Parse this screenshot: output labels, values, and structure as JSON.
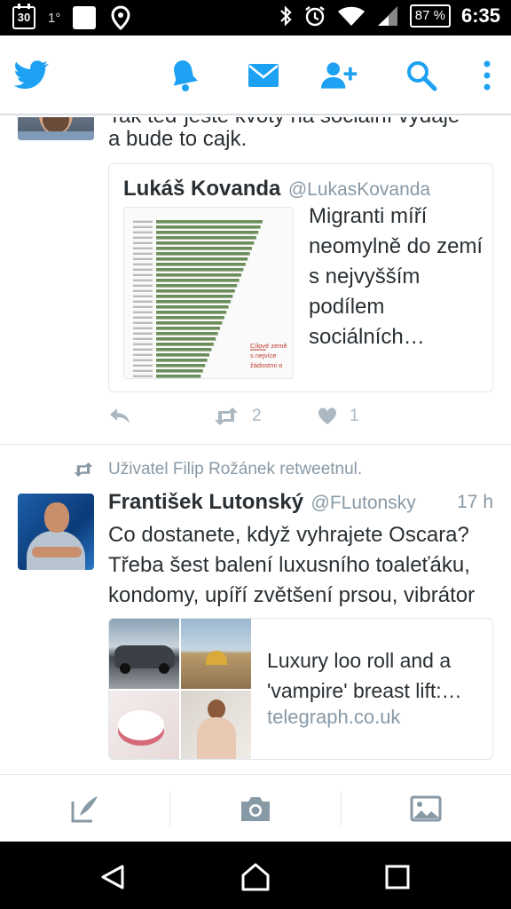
{
  "status_bar": {
    "calendar_day": "30",
    "temperature": "1°",
    "battery": "87 %",
    "time": "6:35"
  },
  "app_bar": {
    "icons": [
      "twitter-logo",
      "notifications-bell",
      "messages-envelope",
      "add-user",
      "search",
      "overflow-menu"
    ],
    "accent_color": "#1da1f2"
  },
  "tweet1": {
    "text_cut": "Tak teď ještě kvóty na sociální výdaje",
    "text_line2": "a bude to cajk.",
    "quote": {
      "name": "Lukáš Kovanda",
      "handle": "@LukasKovanda",
      "text": "Migranti míří neomylně do zemí s nejvyšším podílem sociálních…",
      "image_caption": "Cílové země s nejvíce žádostmi o"
    },
    "actions": {
      "retweet_count": "2",
      "like_count": "1"
    }
  },
  "tweet2": {
    "retweet_notice": "Uživatel Filip Rožánek retweetnul.",
    "name": "František Lutonský",
    "handle": "@FLutonsky",
    "time": "17 h",
    "text": "Co dostanete, když vyhrajete Oscara? Třeba šest balení luxusního toaleťáku, kondomy, upíří zvětšení prsou, vibrátor",
    "card": {
      "title": "Luxury loo roll and a 'vampire' breast lift:…",
      "domain": "telegraph.co.uk"
    }
  },
  "compose_bar": {
    "icons": [
      "compose-tweet",
      "camera",
      "gallery"
    ]
  },
  "nav_bar": {
    "icons": [
      "back",
      "home",
      "recents"
    ]
  }
}
